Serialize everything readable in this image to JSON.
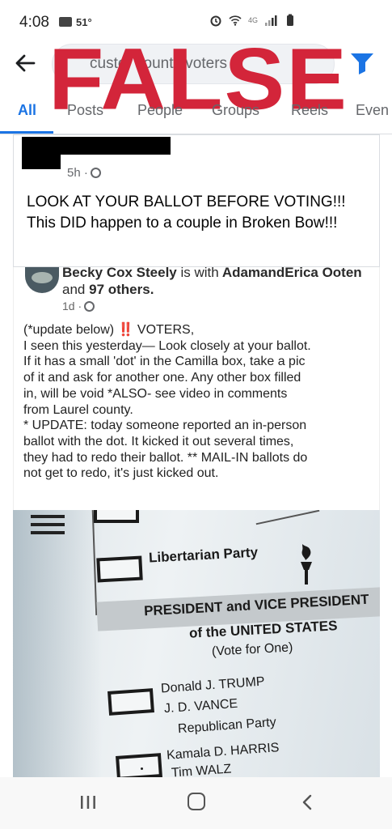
{
  "status_bar": {
    "time": "4:08",
    "temperature": "51°",
    "network": "4G"
  },
  "search": {
    "query": "custer county voters",
    "visible_query": "custer county voters"
  },
  "stamp": {
    "text": "FALSE",
    "color": "#d3253a"
  },
  "tabs": [
    {
      "label": "All",
      "active": true
    },
    {
      "label": "Posts"
    },
    {
      "label": "People"
    },
    {
      "label": "Groups"
    },
    {
      "label": "Reels"
    },
    {
      "label": "Even"
    }
  ],
  "post": {
    "time": "5h ·",
    "text": "LOOK AT YOUR BALLOT BEFORE VOTING!!! This DID happen to a couple in Broken Bow!!!"
  },
  "shared_post": {
    "author_line": "Becky Cox Steely",
    "with_text": "is with",
    "tagged_1": "AdamandErica Ooten",
    "and_text": "and",
    "others": "97 others.",
    "time": "1d ·",
    "body_intro": "(*update below)",
    "body_emphasis": "‼️",
    "body_rest": " VOTERS,",
    "body_lines": [
      "I seen this yesterday— Look closely at your ballot.",
      "If it has a small 'dot' in the Camilla box, take a pic",
      "of it and ask for another one.  Any other box filled",
      "in, will be void *ALSO- see video in comments",
      "from Laurel county.",
      "* UPDATE: today someone reported an in-person",
      "ballot with the dot. It kicked it out several times,",
      "they had to redo their ballot. ** MAIL-IN ballots do",
      "not get to redo, it's just kicked out."
    ]
  },
  "ballot_photo": {
    "libertarian": "Libertarian Party",
    "heading_1": "PRESIDENT and VICE PRESIDENT",
    "heading_2": "of the UNITED STATES",
    "heading_3": "(Vote for One)",
    "candidate_1a": "Donald J. TRUMP",
    "candidate_1b": "J. D. VANCE",
    "candidate_1c": "Republican Party",
    "candidate_2a": "Kamala D. HARRIS",
    "candidate_2b": "Tim WALZ"
  }
}
